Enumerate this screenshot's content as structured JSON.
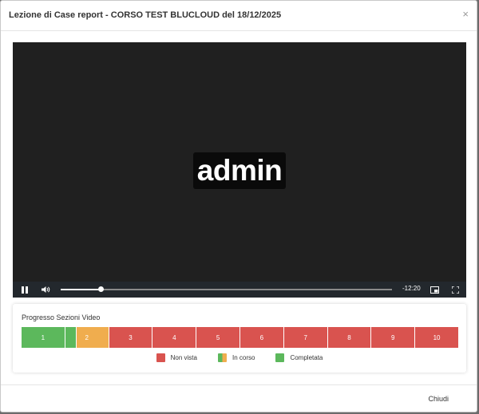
{
  "modal": {
    "title": "Lezione di Case report - CORSO TEST BLUCLOUD del 18/12/2025",
    "close_glyph": "×"
  },
  "video": {
    "watermark": "admin",
    "time_remaining": "-12:20",
    "progress": 0.12,
    "icons": [
      "pause-icon",
      "volume-icon",
      "pip-icon",
      "fullscreen-icon"
    ]
  },
  "progress_panel": {
    "title": "Progresso Sezioni Video",
    "segments": [
      {
        "label": "1",
        "status": "completed"
      },
      {
        "label": "2",
        "status": "in-progress"
      },
      {
        "label": "3",
        "status": "not-viewed"
      },
      {
        "label": "4",
        "status": "not-viewed"
      },
      {
        "label": "5",
        "status": "not-viewed"
      },
      {
        "label": "6",
        "status": "not-viewed"
      },
      {
        "label": "7",
        "status": "not-viewed"
      },
      {
        "label": "8",
        "status": "not-viewed"
      },
      {
        "label": "9",
        "status": "not-viewed"
      },
      {
        "label": "10",
        "status": "not-viewed"
      }
    ],
    "legend": {
      "not_viewed": "Non vista",
      "in_progress": "In corso",
      "completed": "Completata"
    },
    "colors": {
      "not_viewed": "#d9534f",
      "in_progress": "#f0ad4e",
      "completed": "#5cb85c"
    }
  },
  "footer": {
    "close_label": "Chiudi"
  }
}
